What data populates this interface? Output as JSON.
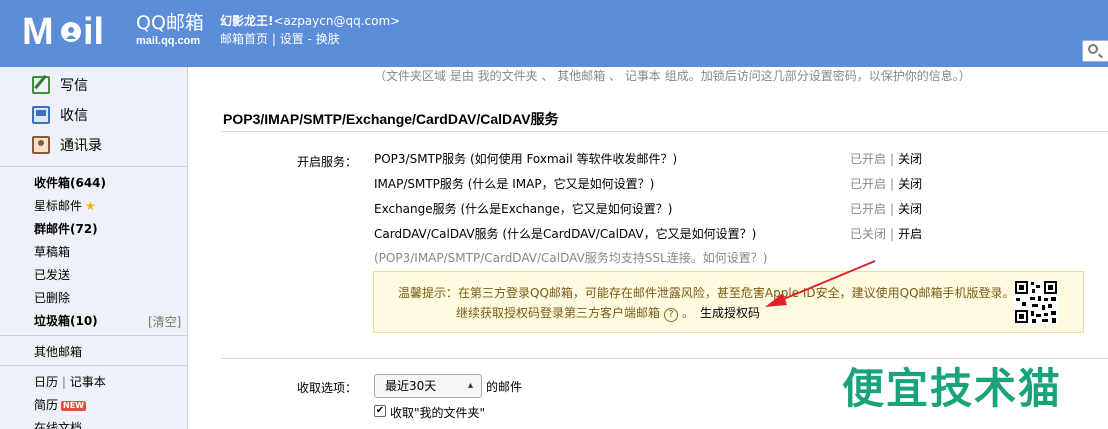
{
  "header": {
    "logo_text": "M◉il",
    "brand_cn": "QQ邮箱",
    "brand_en": "mail.qq.com",
    "user_name": "幻影龙王!",
    "user_email": "<azpaycn@qq.com>",
    "links": [
      "邮箱首页",
      "设置",
      "换肤"
    ]
  },
  "sidebar": {
    "compose": "写信",
    "inbox_main": "收信",
    "contacts": "通讯录",
    "folders": [
      {
        "label": "收件箱(644)",
        "bold": true
      },
      {
        "label": "星标邮件",
        "star": true
      },
      {
        "label": "群邮件(72)",
        "bold": true
      },
      {
        "label": "草稿箱"
      },
      {
        "label": "已发送"
      },
      {
        "label": "已删除"
      },
      {
        "label": "垃圾箱(10)",
        "bold": true
      }
    ],
    "clean": "[清空]",
    "other_mail": "其他邮箱",
    "calendar": "日历",
    "notes": "记事本",
    "resume": "简历",
    "new_badge": "NEW",
    "online_docs": "在线文档"
  },
  "main": {
    "top_note": "（文件夹区域 是由 我的文件夹 、 其他邮箱 、 记事本 组成。加锁后访问这几部分设置密码，以保护你的信息。）",
    "section_title": "POP3/IMAP/SMTP/Exchange/CardDAV/CalDAV服务",
    "open_label": "开启服务：",
    "services": [
      {
        "text": "POP3/SMTP服务 (如何使用 Foxmail 等软件收发邮件？)",
        "status": "已开启",
        "action": "关闭"
      },
      {
        "text": "IMAP/SMTP服务 (什么是 IMAP，它又是如何设置？)",
        "status": "已开启",
        "action": "关闭"
      },
      {
        "text": "Exchange服务 (什么是Exchange，它又是如何设置？)",
        "status": "已开启",
        "action": "关闭"
      },
      {
        "text": "CardDAV/CalDAV服务 (什么是CardDAV/CalDAV，它又是如何设置？)",
        "status": "已关闭",
        "action": "开启"
      }
    ],
    "ssl_note": "(POP3/IMAP/SMTP/CardDAV/CalDAV服务均支持SSL连接。如何设置？)",
    "warning_line1": "温馨提示：在第三方登录QQ邮箱，可能存在邮件泄露风险，甚至危害Apple ID安全，建议使用QQ邮箱手机版登录。",
    "warning_line2": "继续获取授权码登录第三方客户端邮箱",
    "help_icon": "?",
    "generate_code": "生成授权码",
    "recv_label": "收取选项：",
    "recv_select": "最近30天",
    "recv_suffix": "的邮件",
    "checkbox_label": "收取\"我的文件夹\"",
    "watermark": "便宜技术猫"
  },
  "colors": {
    "header_bg": "#5b8dd8",
    "sidebar_bg": "#eef1f7",
    "warning_bg": "#fffbe0",
    "watermark": "#1aa37a",
    "arrow": "#e0202a"
  }
}
